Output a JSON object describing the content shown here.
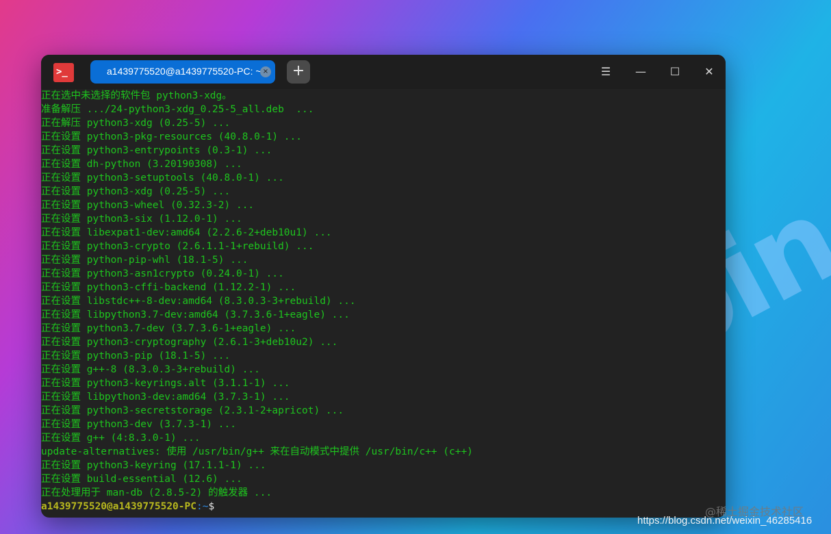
{
  "window": {
    "tab_title": "a1439775520@a1439775520-PC: ~",
    "tab_close_icon": "×",
    "new_tab_icon": "+",
    "menu_icon": "☰",
    "minimize_icon": "—",
    "maximize_icon": "☐",
    "close_icon": "✕"
  },
  "terminal": {
    "lines": [
      "正在选中未选择的软件包 python3-xdg。",
      "准备解压 .../24-python3-xdg_0.25-5_all.deb  ...",
      "正在解压 python3-xdg (0.25-5) ...",
      "正在设置 python3-pkg-resources (40.8.0-1) ...",
      "正在设置 python3-entrypoints (0.3-1) ...",
      "正在设置 dh-python (3.20190308) ...",
      "正在设置 python3-setuptools (40.8.0-1) ...",
      "正在设置 python3-xdg (0.25-5) ...",
      "正在设置 python3-wheel (0.32.3-2) ...",
      "正在设置 python3-six (1.12.0-1) ...",
      "正在设置 libexpat1-dev:amd64 (2.2.6-2+deb10u1) ...",
      "正在设置 python3-crypto (2.6.1.1-1+rebuild) ...",
      "正在设置 python-pip-whl (18.1-5) ...",
      "正在设置 python3-asn1crypto (0.24.0-1) ...",
      "正在设置 python3-cffi-backend (1.12.2-1) ...",
      "正在设置 libstdc++-8-dev:amd64 (8.3.0.3-3+rebuild) ...",
      "正在设置 libpython3.7-dev:amd64 (3.7.3.6-1+eagle) ...",
      "正在设置 python3.7-dev (3.7.3.6-1+eagle) ...",
      "正在设置 python3-cryptography (2.6.1-3+deb10u2) ...",
      "正在设置 python3-pip (18.1-5) ...",
      "正在设置 g++-8 (8.3.0.3-3+rebuild) ...",
      "正在设置 python3-keyrings.alt (3.1.1-1) ...",
      "正在设置 libpython3-dev:amd64 (3.7.3-1) ...",
      "正在设置 python3-secretstorage (2.3.1-2+apricot) ...",
      "正在设置 python3-dev (3.7.3-1) ...",
      "正在设置 g++ (4:8.3.0-1) ...",
      "update-alternatives: 使用 /usr/bin/g++ 来在自动模式中提供 /usr/bin/c++ (c++)",
      "正在设置 python3-keyring (17.1.1-1) ...",
      "正在设置 build-essential (12.6) ...",
      "正在处理用于 man-db (2.8.5-2) 的触发器 ..."
    ],
    "prompt_user": "a1439775520@a1439775520-PC",
    "prompt_sep": ":~",
    "prompt_symbol": "$"
  },
  "watermark": {
    "site": "@稀土掘金技术社区",
    "url": "https://blog.csdn.net/weixin_46285416"
  },
  "colors": {
    "output_text": "#1ec51e",
    "prompt_user": "#b8b81e",
    "tab_active": "#0a6ed6",
    "app_icon": "#e03a3a"
  }
}
